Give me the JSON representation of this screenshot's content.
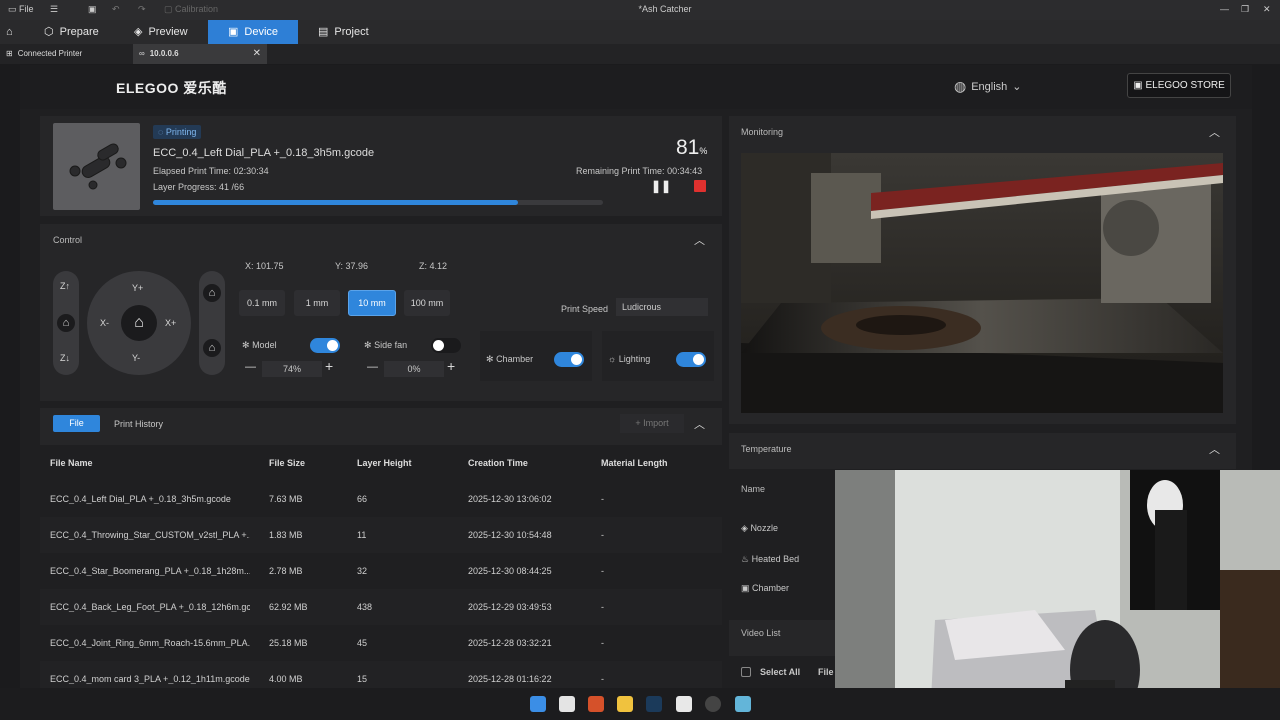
{
  "titlebar": {
    "file": "File",
    "calibration": "Calibration",
    "title": "*Ash Catcher"
  },
  "nav": {
    "prepare": "Prepare",
    "preview": "Preview",
    "device": "Device",
    "project": "Project"
  },
  "subtabs": {
    "connected": "Connected Printer",
    "ip": "10.0.0.6"
  },
  "header": {
    "brand": "ELEGOO 爱乐酷",
    "language": "English",
    "store": "ELEGOO STORE"
  },
  "print": {
    "status": "Printing",
    "filename": "ECC_0.4_Left Dial_PLA +_0.18_3h5m.gcode",
    "elapsed_label": "Elapsed Print Time:",
    "elapsed": "02:30:34",
    "layer_label": "Layer Progress:",
    "layer": "41 /66",
    "percent": "81",
    "percent_unit": "%",
    "remaining_label": "Remaining Print Time:",
    "remaining": "00:34:43",
    "progress": 0.81
  },
  "control": {
    "title": "Control",
    "x": "X:  101.75",
    "y": "Y:  37.96",
    "z": "Z:  4.12",
    "z_up": "Z↑",
    "z_down": "Z↓",
    "y_plus": "Y+",
    "y_minus": "Y-",
    "x_minus": "X-",
    "x_plus": "X+",
    "steps": [
      "0.1 mm",
      "1 mm",
      "10 mm",
      "100 mm"
    ],
    "print_speed_label": "Print Speed",
    "print_speed": "Ludicrous",
    "model_fan": "Model",
    "model_value": "74%",
    "side_fan": "Side fan",
    "side_value": "0%",
    "chamber": "Chamber",
    "lighting": "Lighting"
  },
  "files": {
    "tab_file": "File",
    "tab_history": "Print History",
    "import": "Import",
    "headers": [
      "File Name",
      "File Size",
      "Layer Height",
      "Creation Time",
      "Material Length"
    ],
    "rows": [
      [
        "ECC_0.4_Left Dial_PLA +_0.18_3h5m.gcode",
        "7.63 MB",
        "66",
        "2025-12-30 13:06:02",
        "-"
      ],
      [
        "ECC_0.4_Throwing_Star_CUSTOM_v2stl_PLA +...",
        "1.83 MB",
        "11",
        "2025-12-30 10:54:48",
        "-"
      ],
      [
        "ECC_0.4_Star_Boomerang_PLA +_0.18_1h28m....",
        "2.78 MB",
        "32",
        "2025-12-30 08:44:25",
        "-"
      ],
      [
        "ECC_0.4_Back_Leg_Foot_PLA +_0.18_12h6m.gc...",
        "62.92 MB",
        "438",
        "2025-12-29 03:49:53",
        "-"
      ],
      [
        "ECC_0.4_Joint_Ring_6mm_Roach-15.6mm_PLA...",
        "25.18 MB",
        "45",
        "2025-12-28 03:32:21",
        "-"
      ],
      [
        "ECC_0.4_mom card 3_PLA +_0.12_1h11m.gcode",
        "4.00 MB",
        "15",
        "2025-12-28 01:16:22",
        "-"
      ]
    ]
  },
  "monitoring": {
    "title": "Monitoring"
  },
  "temperature": {
    "title": "Temperature",
    "name": "Name",
    "nozzle": "Nozzle",
    "bed": "Heated Bed",
    "chamber": "Chamber"
  },
  "video": {
    "title": "Video List",
    "select_all": "Select All",
    "file": "File"
  }
}
